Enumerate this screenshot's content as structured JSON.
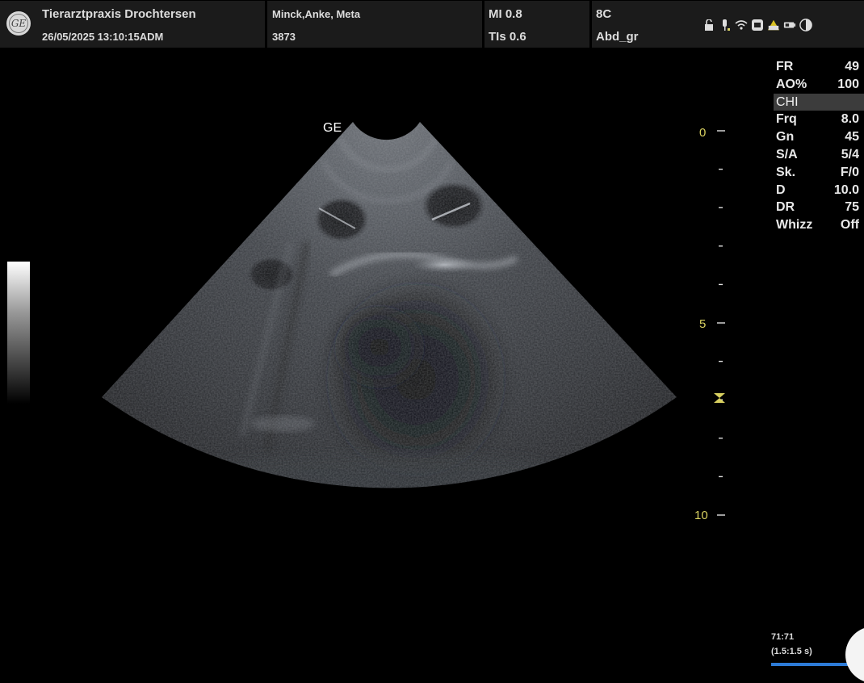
{
  "header": {
    "clinic_name": "Tierarztpraxis Drochtersen",
    "datetime": "26/05/2025 13:10:15ADM",
    "patient_name": "Minck,Anke, Meta",
    "patient_id": "3873",
    "mi": "MI 0.8",
    "tis": "TIs 0.6",
    "probe": "8C",
    "preset": "Abd_gr",
    "logo_text": "GE",
    "icons": [
      "lock-icon",
      "probe-icon",
      "wifi-icon",
      "network-icon",
      "warning-icon",
      "battery-icon",
      "contrast-icon"
    ]
  },
  "params": [
    {
      "label": "FR",
      "value": "49"
    },
    {
      "label": "AO%",
      "value": "100"
    },
    {
      "label": "CHI",
      "value": ""
    },
    {
      "label": "Frq",
      "value": "8.0"
    },
    {
      "label": "Gn",
      "value": "45"
    },
    {
      "label": "S/A",
      "value": "5/4"
    },
    {
      "label": "Sk.",
      "value": "F/0"
    },
    {
      "label": "D",
      "value": "10.0"
    },
    {
      "label": "DR",
      "value": "75"
    },
    {
      "label": "Whizz",
      "value": "Off"
    }
  ],
  "image": {
    "orientation_mark": "GE",
    "depth_labels": [
      "0",
      "5",
      "10"
    ],
    "depth_max_cm": 10,
    "focus_depth_cm": 7
  },
  "cine": {
    "frames": "71:71",
    "duration": "(1.5:1.5 s)",
    "progress": 1.0
  },
  "colors": {
    "depth_scale": "#d8d060",
    "progress": "#2d7bd6",
    "header_bg": "#1b1b1b"
  }
}
